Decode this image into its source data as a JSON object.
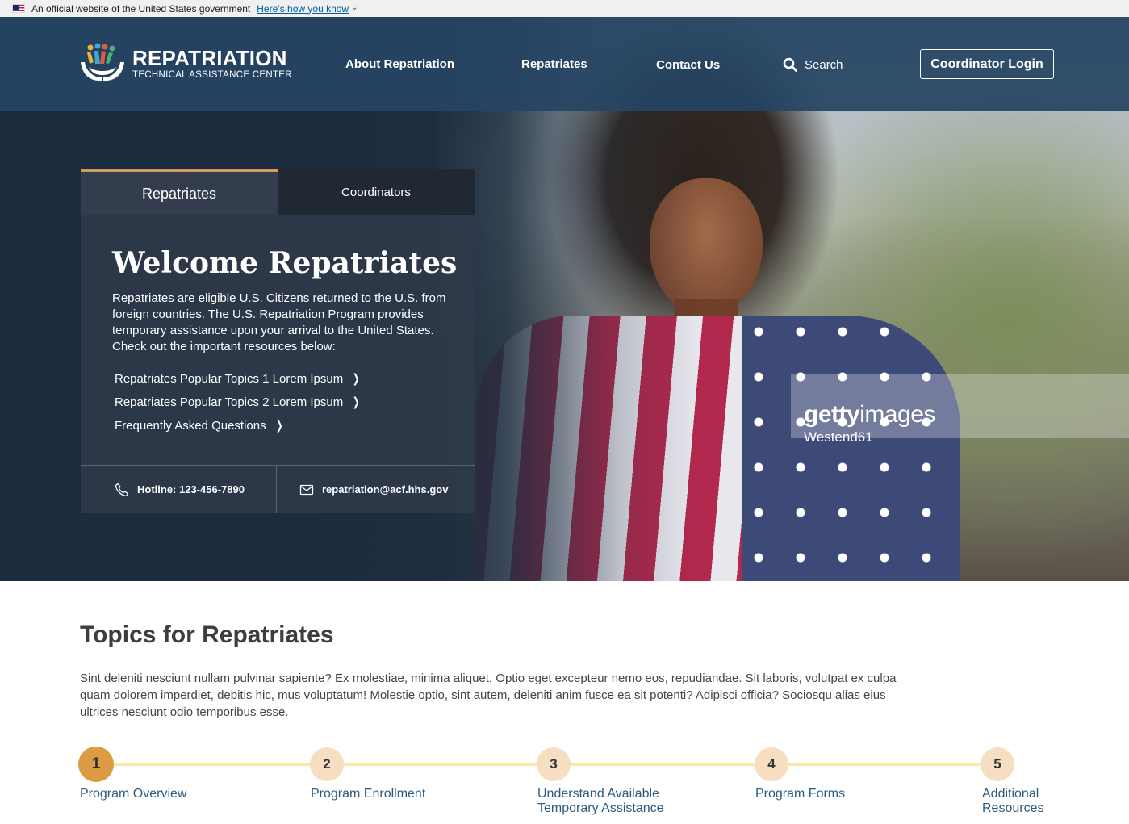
{
  "gov_banner": {
    "text": "An official website of the United States government",
    "link": "Here’s how you know"
  },
  "header": {
    "logo_title": "REPATRIATION",
    "logo_subtitle": "TECHNICAL ASSISTANCE CENTER",
    "nav": [
      "About Repatriation",
      "Repatriates",
      "Contact Us"
    ],
    "search_label": "Search",
    "login_label": "Coordinator Login"
  },
  "hero": {
    "watermark_logo_bold": "getty",
    "watermark_logo_light": "images",
    "watermark_credit": "Westend61"
  },
  "panel": {
    "tabs": [
      "Repatriates",
      "Coordinators"
    ],
    "title": "Welcome Repatriates",
    "description": "Repatriates are eligible U.S. Citizens returned to the U.S. from foreign countries. The U.S. Repatriation Program provides temporary assistance upon your arrival to the United States. Check out the important resources below:",
    "links": [
      "Repatriates Popular Topics 1 Lorem Ipsum",
      "Repatriates Popular Topics 2 Lorem Ipsum",
      "Frequently Asked Questions"
    ],
    "hotline": "Hotline: 123-456-7890",
    "email": "repatriation@acf.hhs.gov"
  },
  "topics": {
    "title": "Topics for Repatriates",
    "text": "Sint deleniti nesciunt nullam pulvinar sapiente? Ex molestiae, minima aliquet. Optio eget excepteur nemo eos, repudiandae. Sit laboris, volutpat ex culpa quam dolorem imperdiet, debitis hic, mus voluptatum! Molestie optio, sint autem, deleniti anim fusce ea sit potenti? Adipisci officia? Sociosqu alias eius ultrices nesciunt odio temporibus esse.",
    "steps": [
      {
        "number": "1",
        "label": "Program Overview"
      },
      {
        "number": "2",
        "label": "Program Enrollment"
      },
      {
        "number": "3",
        "label": "Understand Available Temporary Assistance"
      },
      {
        "number": "4",
        "label": "Program Forms"
      },
      {
        "number": "5",
        "label": "Additional Resources"
      }
    ]
  },
  "colors": {
    "header_bg": "#264563",
    "tab_accent": "#d29c5a",
    "step_active": "#dd9b44",
    "step_inactive": "#f5dfc0",
    "step_line": "#f7eaa8",
    "step_label": "#2f5a80"
  }
}
